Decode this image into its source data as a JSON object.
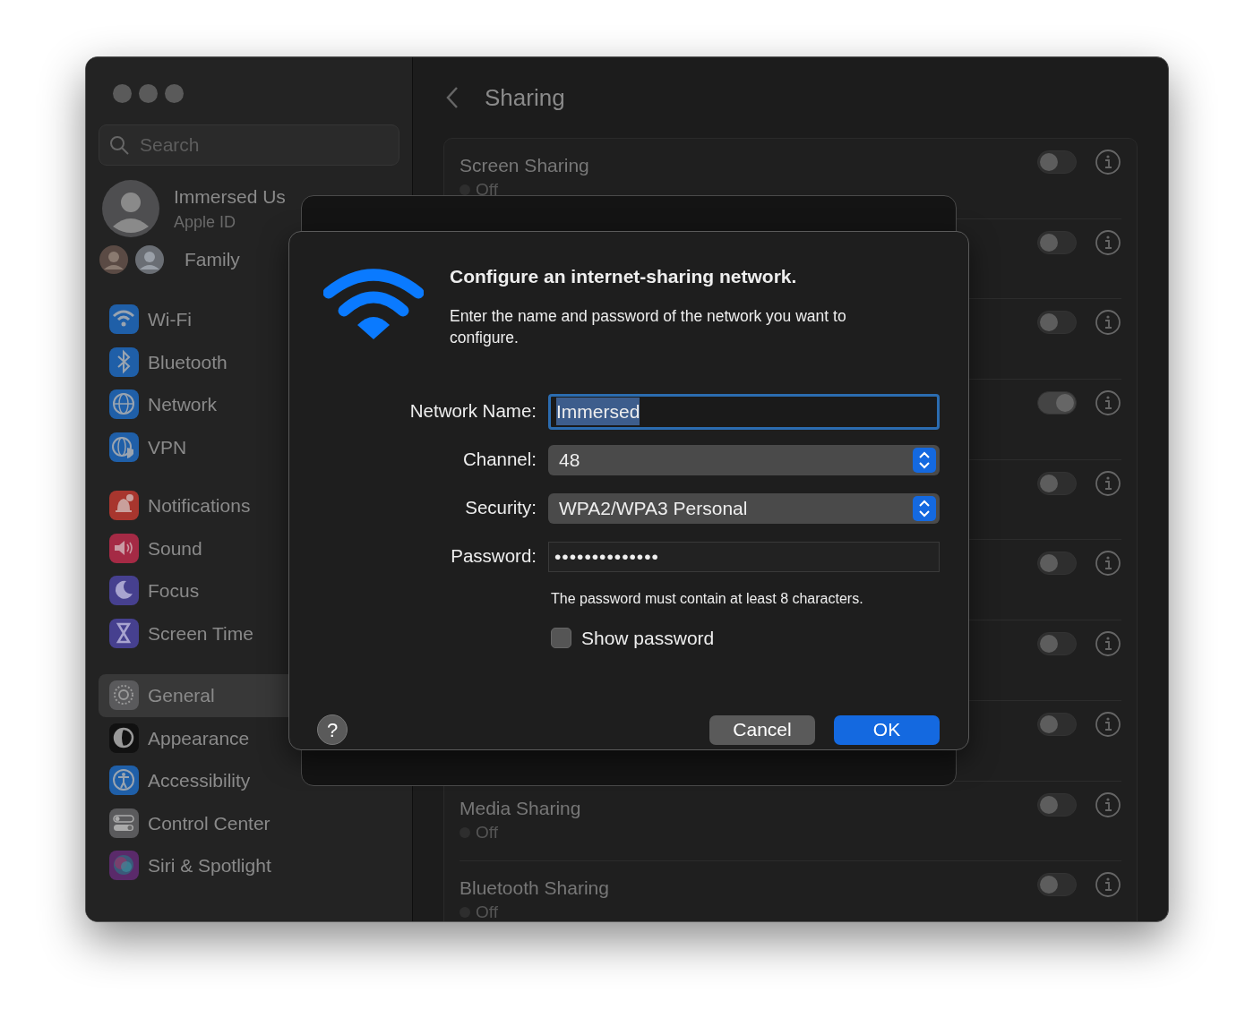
{
  "window": {
    "title": "Sharing"
  },
  "sidebar": {
    "search": {
      "placeholder": "Search"
    },
    "account": {
      "name": "Immersed Us",
      "subtitle": "Apple ID"
    },
    "family": {
      "label": "Family"
    },
    "groups": [
      [
        {
          "label": "Wi-Fi",
          "color": "#1f5fa8",
          "selected": false
        },
        {
          "label": "Bluetooth",
          "color": "#1f5fa8",
          "selected": false
        },
        {
          "label": "Network",
          "color": "#1f5fa8",
          "selected": false
        },
        {
          "label": "VPN",
          "color": "#1f5fa8",
          "selected": false
        }
      ],
      [
        {
          "label": "Notifications",
          "color": "#a8362e",
          "selected": false
        },
        {
          "label": "Sound",
          "color": "#a52a45",
          "selected": false
        },
        {
          "label": "Focus",
          "color": "#46408f",
          "selected": false
        },
        {
          "label": "Screen Time",
          "color": "#46408f",
          "selected": false
        }
      ],
      [
        {
          "label": "General",
          "color": "#5a5a5c",
          "selected": true
        },
        {
          "label": "Appearance",
          "color": "#111111",
          "selected": false
        },
        {
          "label": "Accessibility",
          "color": "#1f5fa8",
          "selected": false
        },
        {
          "label": "Control Center",
          "color": "#5a5a5c",
          "selected": false
        },
        {
          "label": "Siri & Spotlight",
          "color": "#5a2a6a",
          "selected": false
        }
      ]
    ]
  },
  "services": [
    {
      "title": "Screen Sharing",
      "status": "Off",
      "on": false
    },
    {
      "on": false
    },
    {
      "on": false
    },
    {
      "on": true
    },
    {
      "on": false
    },
    {
      "on": false
    },
    {
      "on": false
    },
    {
      "on": false
    },
    {
      "title": "Media Sharing",
      "status": "Off",
      "on": false
    },
    {
      "title": "Bluetooth Sharing",
      "status": "Off",
      "on": false
    }
  ],
  "dialog": {
    "title": "Configure an internet-sharing network.",
    "message": "Enter the name and password of the network you want to configure.",
    "fields": [
      {
        "kind": "text",
        "label": "Network Name:",
        "value": "Immersed",
        "selected": true
      },
      {
        "kind": "popup",
        "label": "Channel:",
        "value": "48"
      },
      {
        "kind": "popup",
        "label": "Security:",
        "value": "WPA2/WPA3 Personal"
      },
      {
        "kind": "password",
        "label": "Password:",
        "value": "••••••••••••••"
      }
    ],
    "hint": "The password must contain at least 8 characters.",
    "show_password": {
      "label": "Show password",
      "checked": false
    },
    "help": "?",
    "buttons": [
      {
        "label": "Cancel",
        "kind": "secondary"
      },
      {
        "label": "OK",
        "kind": "primary"
      }
    ]
  }
}
